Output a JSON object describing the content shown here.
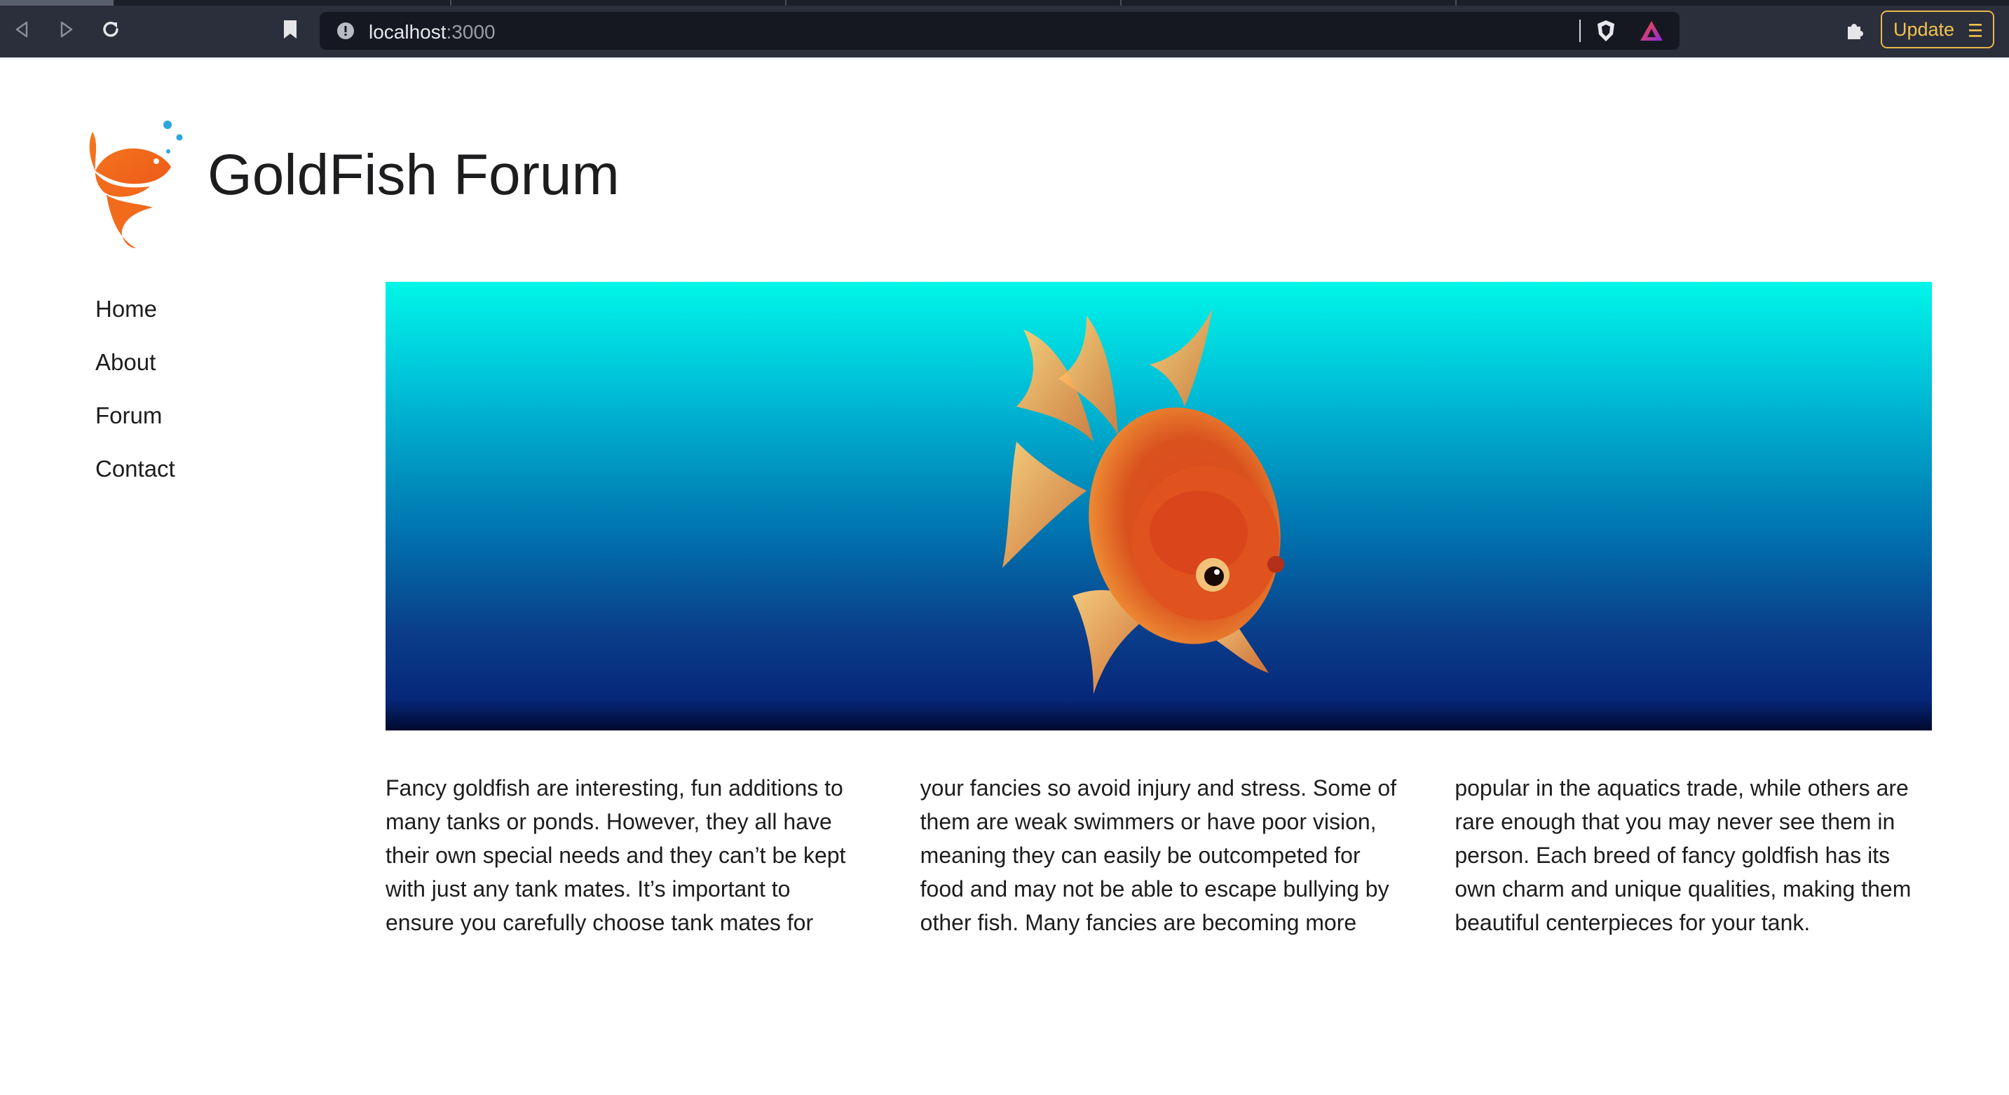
{
  "browser": {
    "url_host": "localhost",
    "url_port": ":3000",
    "update_label": "Update",
    "icons": [
      "back-icon",
      "forward-icon",
      "reload-icon",
      "bookmark-icon",
      "site-info-icon",
      "brave-shield-icon",
      "brave-rewards-icon",
      "extensions-icon",
      "menu-icon"
    ]
  },
  "site": {
    "title": "GoldFish Forum",
    "logo": "goldfish-logo"
  },
  "nav": {
    "items": [
      {
        "label": "Home"
      },
      {
        "label": "About"
      },
      {
        "label": "Forum"
      },
      {
        "label": "Contact"
      }
    ]
  },
  "hero": {
    "image": "goldfish-hero-image"
  },
  "content": {
    "paragraph": "Fancy goldfish are interesting, fun additions to many tanks or ponds. However, they all have their own special needs and they can’t be kept with just any tank mates. It’s important to ensure you carefully choose tank mates for your fancies so avoid injury and stress. Some of them are weak swimmers or have poor vision, meaning they can easily be outcompeted for food and may not be able to escape bullying by other fish. Many fancies are becoming more popular in the aquatics trade, while others are rare enough that you may never see them in person. Each breed of fancy goldfish has its own charm and unique qualities, making them beautiful centerpieces for your tank."
  },
  "colors": {
    "chrome": "#2b2e3b",
    "urlbar": "#161821",
    "update_accent": "#e6b84a",
    "hero_top": "#00f6e8",
    "hero_bottom": "#00092e",
    "logo_orange": "#f26b1d",
    "bubble_blue": "#2aa6e0"
  }
}
